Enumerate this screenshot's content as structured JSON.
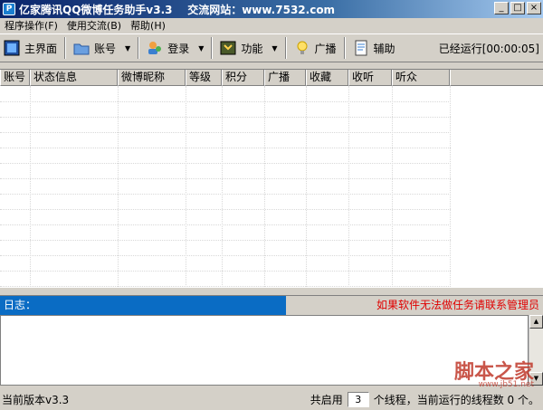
{
  "window": {
    "title": "亿家腾讯QQ微博任务助手v3.3    交流网站：www.7532.com",
    "icon": "app-logo",
    "buttons": [
      "_",
      "□",
      "×"
    ]
  },
  "menu": [
    "程序操作(F)",
    "使用交流(B)",
    "帮助(H)"
  ],
  "toolbar": {
    "home": "主界面",
    "account": "账号",
    "login": "登录",
    "function": "功能",
    "broadcast": "广播",
    "assist": "辅助",
    "runtime": "已经运行[00:00:05]"
  },
  "table": {
    "columns": [
      "账号",
      "状态信息",
      "微博昵称",
      "等级",
      "积分",
      "广播",
      "收藏",
      "收听",
      "听众"
    ]
  },
  "log": {
    "label": "日志：",
    "warning": "如果软件无法做任务请联系管理员",
    "warning_color": "#e00000"
  },
  "status": {
    "version": "当前版本v3.3",
    "threads_prefix": "共启用",
    "threads_value": "3",
    "threads_suffix": "个线程，当前运行的线程数 0 个。"
  },
  "watermark": {
    "text": "脚本之家",
    "url": "www.jb51.net"
  }
}
